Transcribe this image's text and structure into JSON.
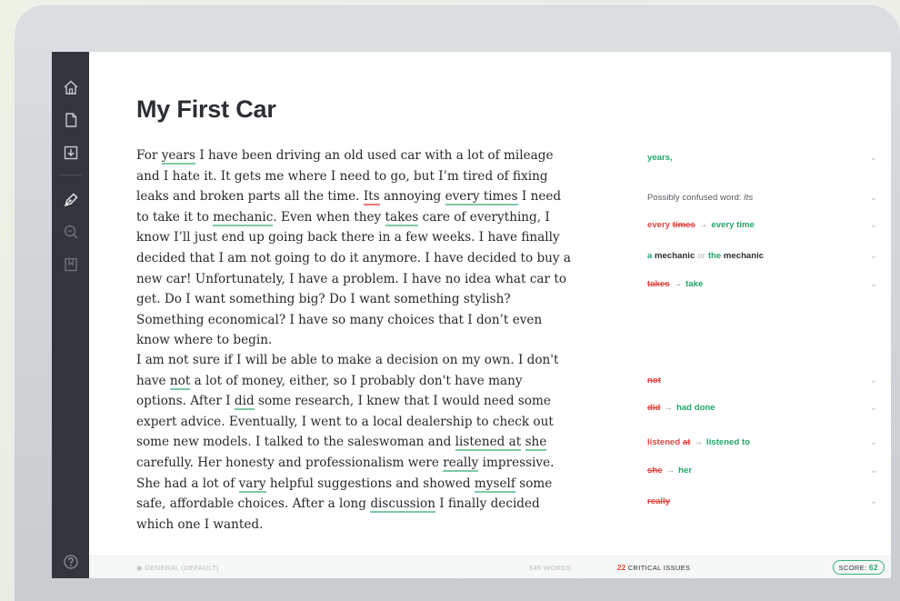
{
  "document": {
    "title": "My First Car",
    "paragraph1": [
      {
        "t": "For "
      },
      {
        "t": "years",
        "hl": "g"
      },
      {
        "t": " I have been driving an old used car with a lot of mileage and I hate it. It gets me where I need to go, but I’m tired of fixing leaks and broken parts all the time. "
      },
      {
        "t": "Its",
        "hl": "r"
      },
      {
        "t": " annoying "
      },
      {
        "t": "every times",
        "hl": "g"
      },
      {
        "t": " I need to take it to "
      },
      {
        "t": "mechanic",
        "hl": "g"
      },
      {
        "t": ". Even when they "
      },
      {
        "t": "takes",
        "hl": "g"
      },
      {
        "t": " care of everything, I know I’ll just end up going back there in a few weeks. I have finally decided that I am not going to do it anymore. I have decided to buy a new car! Unfortunately, I have a problem. I have no idea what car to get. Do I want something big? Do I want something stylish? Something economical? I have so many choices that I don’t even know where to begin."
      }
    ],
    "paragraph2": [
      {
        "t": "I am not sure if I will be able to make a decision on my own. I don't have "
      },
      {
        "t": "not",
        "hl": "g"
      },
      {
        "t": "  a lot of money, either, so I probably don't have many options. After I "
      },
      {
        "t": "did",
        "hl": "g"
      },
      {
        "t": " some research, I knew that I would need some expert advice. Eventually, I went to a local dealership to check out some new models. I talked to the saleswoman and "
      },
      {
        "t": "listened at",
        "hl": "g"
      },
      {
        "t": " "
      },
      {
        "t": "she",
        "hl": "g"
      },
      {
        "t": " carefully. Her honesty and professionalism were "
      },
      {
        "t": "really",
        "hl": "g"
      },
      {
        "t": " impressive. She had a lot of "
      },
      {
        "t": "vary",
        "hl": "g"
      },
      {
        "t": " helpful suggestions and showed "
      },
      {
        "t": "myself",
        "hl": "g"
      },
      {
        "t": " some safe, affordable choices. After a long "
      },
      {
        "t": "discussion",
        "hl": "g"
      },
      {
        "t": " I finally decided which one I wanted."
      }
    ]
  },
  "cards": [
    {
      "parts": [
        {
          "t": "years,",
          "c": "green"
        }
      ]
    },
    {
      "parts": [
        {
          "t": "Possibly confused word: ",
          "c": "gray"
        },
        {
          "t": "Its",
          "c": "gray-italic"
        }
      ]
    },
    {
      "parts": [
        {
          "t": "every ",
          "c": "red"
        },
        {
          "t": "times",
          "c": "strike"
        },
        {
          "t": "→",
          "c": "arrow"
        },
        {
          "t": "every time",
          "c": "green"
        }
      ]
    },
    {
      "parts": [
        {
          "t": "a ",
          "c": "green"
        },
        {
          "t": "mechanic",
          "c": "dark"
        },
        {
          "t": "or",
          "c": "or"
        },
        {
          "t": "the ",
          "c": "green"
        },
        {
          "t": "mechanic",
          "c": "dark"
        }
      ]
    },
    {
      "parts": [
        {
          "t": "takes",
          "c": "strike"
        },
        {
          "t": "→",
          "c": "arrow"
        },
        {
          "t": "take",
          "c": "green"
        }
      ]
    },
    {
      "parts": [
        {
          "t": "not",
          "c": "strike"
        }
      ]
    },
    {
      "parts": [
        {
          "t": "did",
          "c": "strike"
        },
        {
          "t": "→",
          "c": "arrow"
        },
        {
          "t": "had done",
          "c": "green"
        }
      ]
    },
    {
      "parts": [
        {
          "t": "listened ",
          "c": "red"
        },
        {
          "t": "at",
          "c": "strike"
        },
        {
          "t": "→",
          "c": "arrow"
        },
        {
          "t": "listened ",
          "c": "green"
        },
        {
          "t": "to",
          "c": "green"
        }
      ]
    },
    {
      "parts": [
        {
          "t": "she",
          "c": "strike"
        },
        {
          "t": "→",
          "c": "arrow"
        },
        {
          "t": "her",
          "c": "green"
        }
      ]
    },
    {
      "parts": [
        {
          "t": "really",
          "c": "strike"
        }
      ]
    }
  ],
  "card_controls": {
    "expand": "⌄",
    "dismiss": "×"
  },
  "footer": {
    "mode": "General (default)",
    "words": "545 words",
    "critical_count": "22",
    "critical_label": "critical issues",
    "score_label": "Score:",
    "score_value": "62"
  },
  "sidebar": {
    "icons": [
      "home-icon",
      "document-icon",
      "download-icon",
      "pen-icon",
      "search-icon",
      "book-icon",
      "help-icon"
    ]
  },
  "colors": {
    "sidebar": "#33363c",
    "accent_green": "#1fa76a",
    "accent_red": "#e0453f"
  }
}
